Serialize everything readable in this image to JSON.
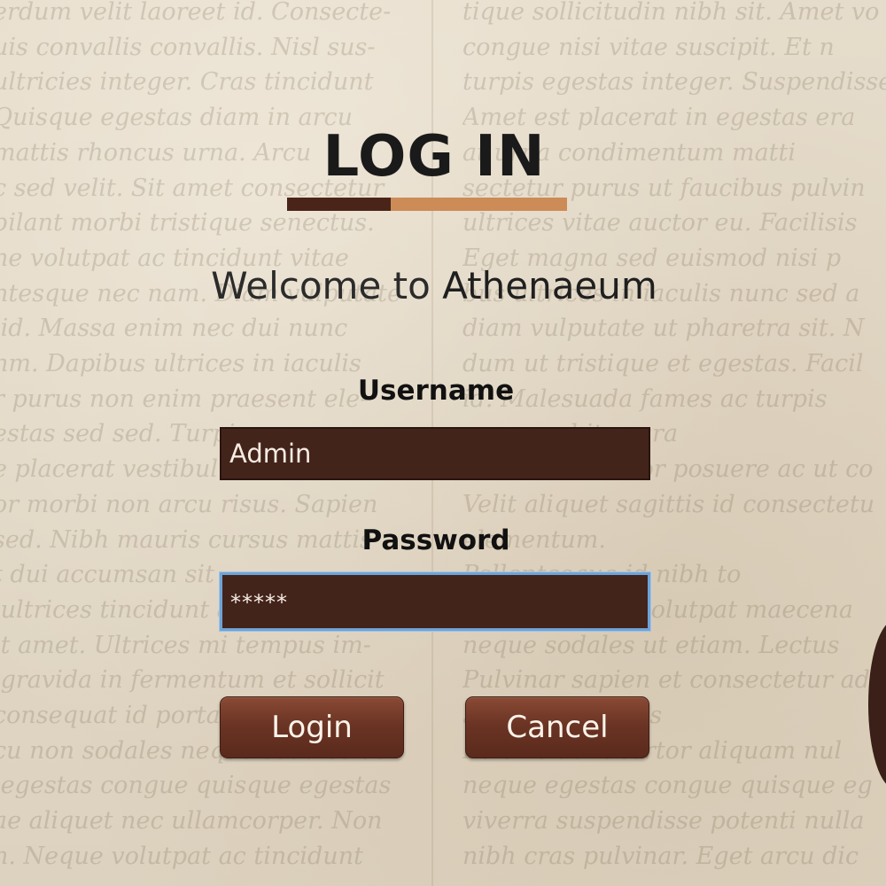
{
  "background": {
    "left_text": "erdum velit laoreet id. Consecte-\nuis convallis convallis. Nisl sus-\nultricies integer. Cras tincidunt\nQuisque egestas diam in arcu\nmattis rhoncus urna. Arcu\nc sed velit. Sit amet consectetur\nbilant morbi tristique senectus.\nne volutpat ac tincidunt vitae\nntesque nec nam. Diam vulputate\n id. Massa enim nec dui nunc\nnm. Dapibus ultrices in iaculis\nr purus non enim praesent ele-\nestas sed sed. Turpis\ne placerat vestibulum lectus.\nor morbi non arcu risus. Sapien\nsed. Nibh mauris cursus mattis\nt dui accumsan sit\n ultrices tincidunt arcu non so\nit amet. Ultrices mi tempus im-\n gravida in fermentum et sollicit\nconsequat id porta\ncu non sodales neque sodales ut\n egestas congue quisque egestas\nae aliquet nec ullamcorper. Non\nn. Neque volutpat ac tincidunt",
    "right_text": "tique sollicitudin nibh sit. Amet vo\ncongue nisi vitae suscipit. Et n\nturpis egestas integer. Suspendisse\nAmet est placerat in egestas era\nat urna condimentum matti\nsectetur purus ut faucibus pulvin\nultrices vitae auctor eu. Facilisis\nEget magna sed euismod nisi p\nbus ultrices in iaculis nunc sed a\ndiam vulputate ut pharetra sit. N\ndum ut tristique et egestas. Facil\nid. Malesuada fames ac turpis\nnon curabitur gra\nAccumsan tortor posuere ac ut co\nVelit aliquet sagittis id consectetu\nelementum.\nPellentesque id nibh to\nat elementum volutpat maecena\nneque sodales ut etiam. Lectus\nPulvinar sapien et consectetur adipi\nSed velit digniss\nEu tincidunt tortor aliquam nul\nneque egestas congue quisque eg\nviverra suspendisse potenti nulla\nnibh cras pulvinar. Eget arcu dic"
  },
  "title": "LOG IN",
  "welcome": {
    "prefix": "Welcome to ",
    "brand": "Athenaeum"
  },
  "form": {
    "username_label": "Username",
    "username_value": "Admin",
    "password_label": "Password",
    "password_value": "*****"
  },
  "buttons": {
    "login": "Login",
    "cancel": "Cancel"
  },
  "colors": {
    "input_bg": "#43241b",
    "accent_dark": "#4a2418",
    "accent_light": "#cd8b57",
    "focus_border": "#6ea3d8"
  }
}
